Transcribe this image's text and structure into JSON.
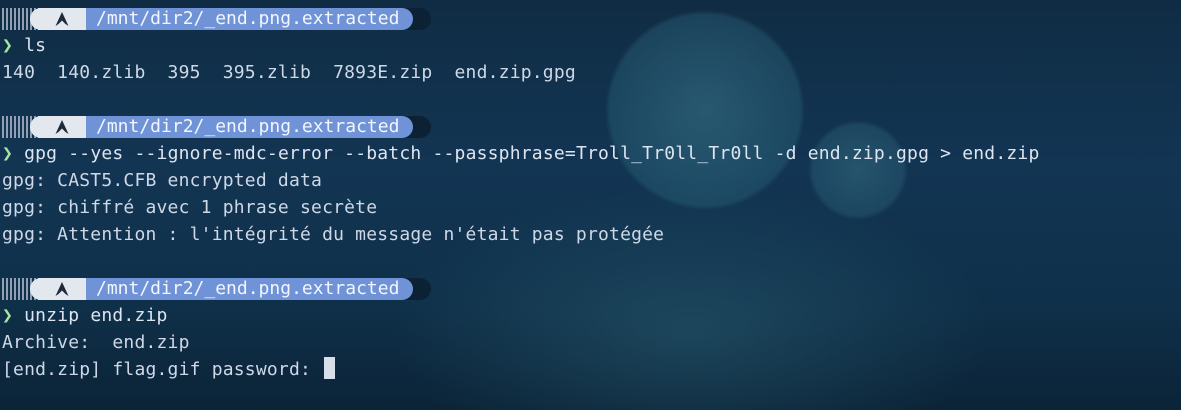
{
  "theme": {
    "prompt_path_bg": "#6f93d6",
    "prompt_os_bg": "#e3e8ef",
    "chevron_color": "#a6e3a1",
    "os_icon": "arch-linux-icon"
  },
  "blocks": [
    {
      "prompt_path": "/mnt/dir2/_end.png.extracted",
      "chevron": "❯",
      "command": "ls",
      "output": [
        "140  140.zlib  395  395.zlib  7893E.zip  end.zip.gpg"
      ]
    },
    {
      "prompt_path": "/mnt/dir2/_end.png.extracted",
      "chevron": "❯",
      "command": "gpg --yes --ignore-mdc-error --batch --passphrase=Troll_Tr0ll_Tr0ll -d end.zip.gpg > end.zip",
      "output": [
        "gpg: CAST5.CFB encrypted data",
        "gpg: chiffré avec 1 phrase secrète",
        "gpg: Attention : l'intégrité du message n'était pas protégée"
      ]
    },
    {
      "prompt_path": "/mnt/dir2/_end.png.extracted",
      "chevron": "❯",
      "command": "unzip end.zip",
      "output": [
        "Archive:  end.zip",
        "[end.zip] flag.gif password: "
      ]
    }
  ]
}
